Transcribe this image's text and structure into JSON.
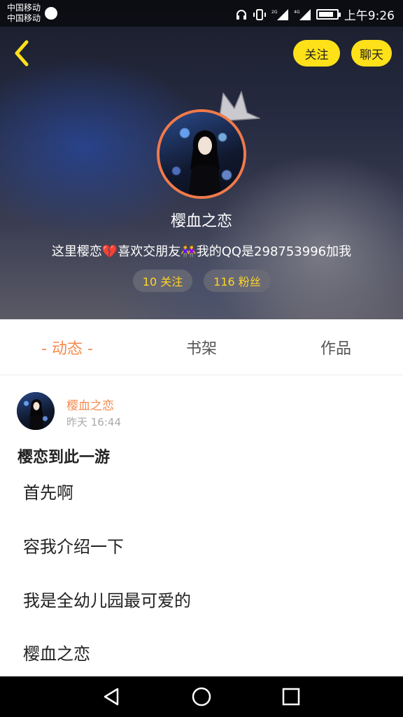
{
  "status_bar": {
    "carrier_1": "中国移动",
    "carrier_2": "中国移动",
    "network_1": "2G",
    "network_2": "4G",
    "time": "上午9:26"
  },
  "header": {
    "follow_label": "关注",
    "chat_label": "聊天",
    "accent_color": "#ffe11a"
  },
  "profile": {
    "name": "樱血之恋",
    "bio": "这里樱恋💔喜欢交朋友👭我的QQ是298753996加我",
    "following_stat": "10 关注",
    "fans_stat": "116 粉丝"
  },
  "tabs": [
    {
      "label": "- 动态 -",
      "active": true
    },
    {
      "label": "书架",
      "active": false
    },
    {
      "label": "作品",
      "active": false
    }
  ],
  "post": {
    "author": "樱血之恋",
    "time": "昨天 16:44",
    "title": "樱恋到此一游",
    "lines": [
      "首先啊",
      "容我介绍一下",
      "我是全幼儿园最可爱的",
      "樱血之恋"
    ]
  },
  "icons": [
    "back-arrow-icon",
    "crown-icon",
    "headset-icon",
    "vibrate-icon",
    "signal-icon",
    "battery-icon",
    "nav-back-icon",
    "nav-home-icon",
    "nav-recent-icon"
  ]
}
